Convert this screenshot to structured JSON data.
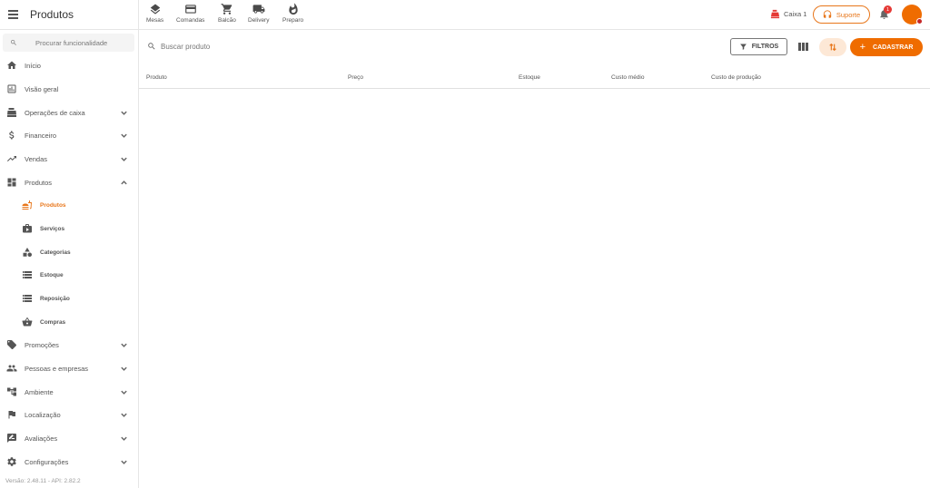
{
  "header": {
    "title": "Produtos",
    "quick_actions": [
      {
        "label": "Mesas",
        "icon": "layers-icon"
      },
      {
        "label": "Comandas",
        "icon": "card-icon"
      },
      {
        "label": "Balcão",
        "icon": "cart-icon"
      },
      {
        "label": "Delivery",
        "icon": "truck-icon"
      },
      {
        "label": "Preparo",
        "icon": "flame-icon"
      }
    ],
    "caixa_label": "Caixa 1",
    "support_label": "Suporte",
    "notification_count": "1"
  },
  "sidebar": {
    "search_placeholder": "Procurar funcionalidade",
    "items": [
      {
        "label": "Início",
        "icon": "home-icon"
      },
      {
        "label": "Visão geral",
        "icon": "chart-box-icon"
      },
      {
        "label": "Operações de caixa",
        "icon": "cash-register-icon"
      },
      {
        "label": "Financeiro",
        "icon": "dollar-icon"
      },
      {
        "label": "Vendas",
        "icon": "trending-up-icon"
      },
      {
        "label": "Produtos",
        "icon": "dashboard-icon"
      },
      {
        "label": "Promoções",
        "icon": "tag-icon"
      },
      {
        "label": "Pessoas e empresas",
        "icon": "people-icon"
      },
      {
        "label": "Ambiente",
        "icon": "hierarchy-icon"
      },
      {
        "label": "Localização",
        "icon": "flag-icon"
      },
      {
        "label": "Avaliações",
        "icon": "rate-review-icon"
      },
      {
        "label": "Configurações",
        "icon": "gear-icon"
      }
    ],
    "sub_items": [
      {
        "label": "Produtos",
        "icon": "fastfood-icon",
        "active": true
      },
      {
        "label": "Serviços",
        "icon": "service-icon"
      },
      {
        "label": "Categorias",
        "icon": "category-icon"
      },
      {
        "label": "Estoque",
        "icon": "storage-icon"
      },
      {
        "label": "Reposição",
        "icon": "restock-icon"
      },
      {
        "label": "Compras",
        "icon": "basket-icon"
      }
    ],
    "version": "Versão: 2.48.11 - API: 2.82.2"
  },
  "main": {
    "search_placeholder": "Buscar produto",
    "filters_label": "FILTROS",
    "add_label": "CADASTRAR",
    "columns": [
      "Produto",
      "Preço",
      "Estoque",
      "Custo médio",
      "Custo de produção"
    ]
  },
  "colors": {
    "accent": "#ef6c00",
    "accent_text": "#e8761a",
    "accent_light": "#fde8d6",
    "alert": "#e53935"
  }
}
